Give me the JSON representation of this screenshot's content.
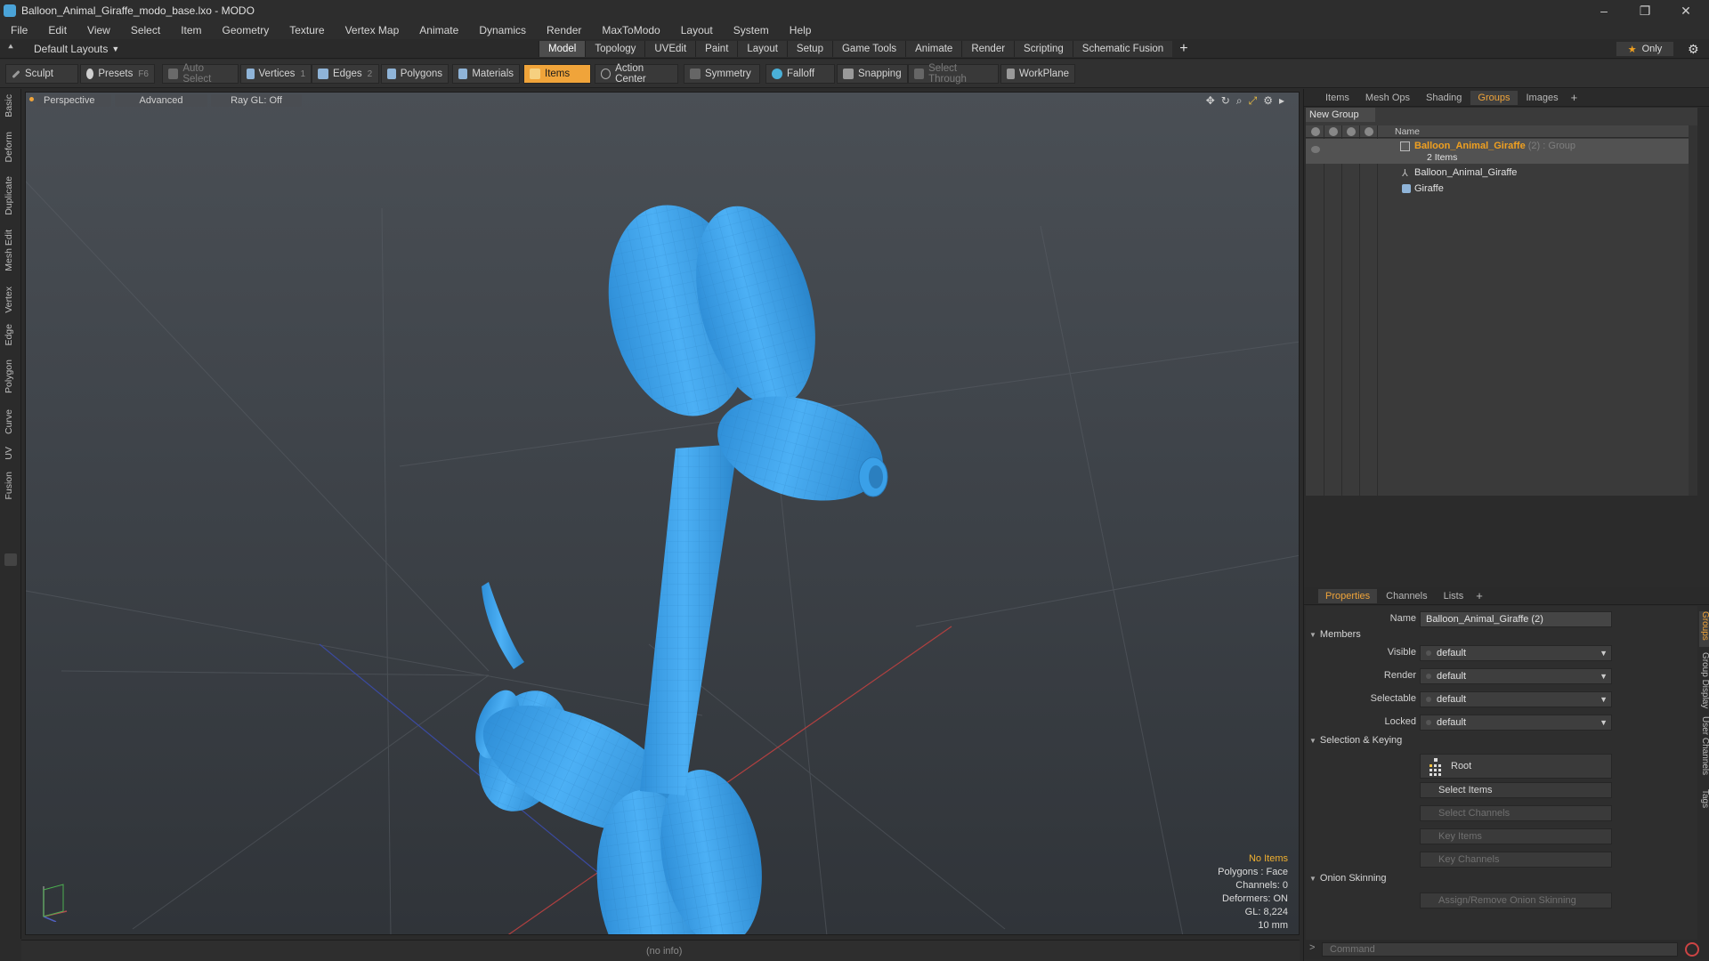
{
  "window": {
    "title": "Balloon_Animal_Giraffe_modo_base.lxo - MODO",
    "controls": {
      "minimize": "–",
      "maximize": "❐",
      "close": "✕"
    }
  },
  "menu": [
    "File",
    "Edit",
    "View",
    "Select",
    "Item",
    "Geometry",
    "Texture",
    "Vertex Map",
    "Animate",
    "Dynamics",
    "Render",
    "MaxToModo",
    "Layout",
    "System",
    "Help"
  ],
  "layouts": {
    "dropdown_label": "Default Layouts",
    "tabs": [
      "Model",
      "Topology",
      "UVEdit",
      "Paint",
      "Layout",
      "Setup",
      "Game Tools",
      "Animate",
      "Render",
      "Scripting",
      "Schematic Fusion"
    ],
    "active_tab": "Model",
    "only_label": "Only"
  },
  "toolbar": {
    "sculpt": "Sculpt",
    "presets": "Presets",
    "presets_key": "F6",
    "auto_select": "Auto Select",
    "vertices": "Vertices",
    "vertices_key": "1",
    "edges": "Edges",
    "edges_key": "2",
    "polygons": "Polygons",
    "materials": "Materials",
    "items": "Items",
    "action_center": "Action Center",
    "symmetry": "Symmetry",
    "falloff": "Falloff",
    "snapping": "Snapping",
    "select_through": "Select Through",
    "workplane": "WorkPlane"
  },
  "left_tabs": [
    "Basic",
    "Deform",
    "Duplicate",
    "Mesh Edit",
    "Vertex",
    "Edge",
    "Polygon",
    "Curve",
    "UV",
    "Fusion"
  ],
  "viewport": {
    "perspective": "Perspective",
    "advanced": "Advanced",
    "raygl": "Ray GL: Off",
    "info": {
      "no_items": "No Items",
      "polygons": "Polygons : Face",
      "channels": "Channels: 0",
      "deformers": "Deformers: ON",
      "gl": "GL: 8,224",
      "scale": "10 mm"
    },
    "model_color": "#3fa3ee"
  },
  "status": {
    "info": "(no info)"
  },
  "groups_panel": {
    "tabs": [
      "Items",
      "Mesh Ops",
      "Shading",
      "Groups",
      "Images"
    ],
    "active_tab": "Groups",
    "new_group": "New Group",
    "column_name": "Name",
    "group_name": "Balloon_Animal_Giraffe",
    "group_count": "(2)",
    "group_type": ": Group",
    "group_items": "2 Items",
    "children": [
      "Balloon_Animal_Giraffe",
      "Giraffe"
    ]
  },
  "properties": {
    "tabs": [
      "Properties",
      "Channels",
      "Lists"
    ],
    "active_tab": "Properties",
    "name_label": "Name",
    "name_value": "Balloon_Animal_Giraffe (2)",
    "members_section": "Members",
    "visible_label": "Visible",
    "visible_value": "default",
    "render_label": "Render",
    "render_value": "default",
    "selectable_label": "Selectable",
    "selectable_value": "default",
    "locked_label": "Locked",
    "locked_value": "default",
    "selection_section": "Selection & Keying",
    "root_btn": "Root",
    "select_items": "Select Items",
    "select_channels": "Select Channels",
    "key_items": "Key Items",
    "key_channels": "Key Channels",
    "onion_section": "Onion Skinning",
    "assign_onion": "Assign/Remove Onion Skinning",
    "side_tabs": [
      "Groups",
      "Group Display",
      "User Channels",
      "Tags"
    ]
  },
  "command": {
    "placeholder": "Command",
    "prompt": ">"
  },
  "colors": {
    "accent": "#f0a43a",
    "group_name": "#f0a020",
    "model": "#3fa3ee"
  }
}
